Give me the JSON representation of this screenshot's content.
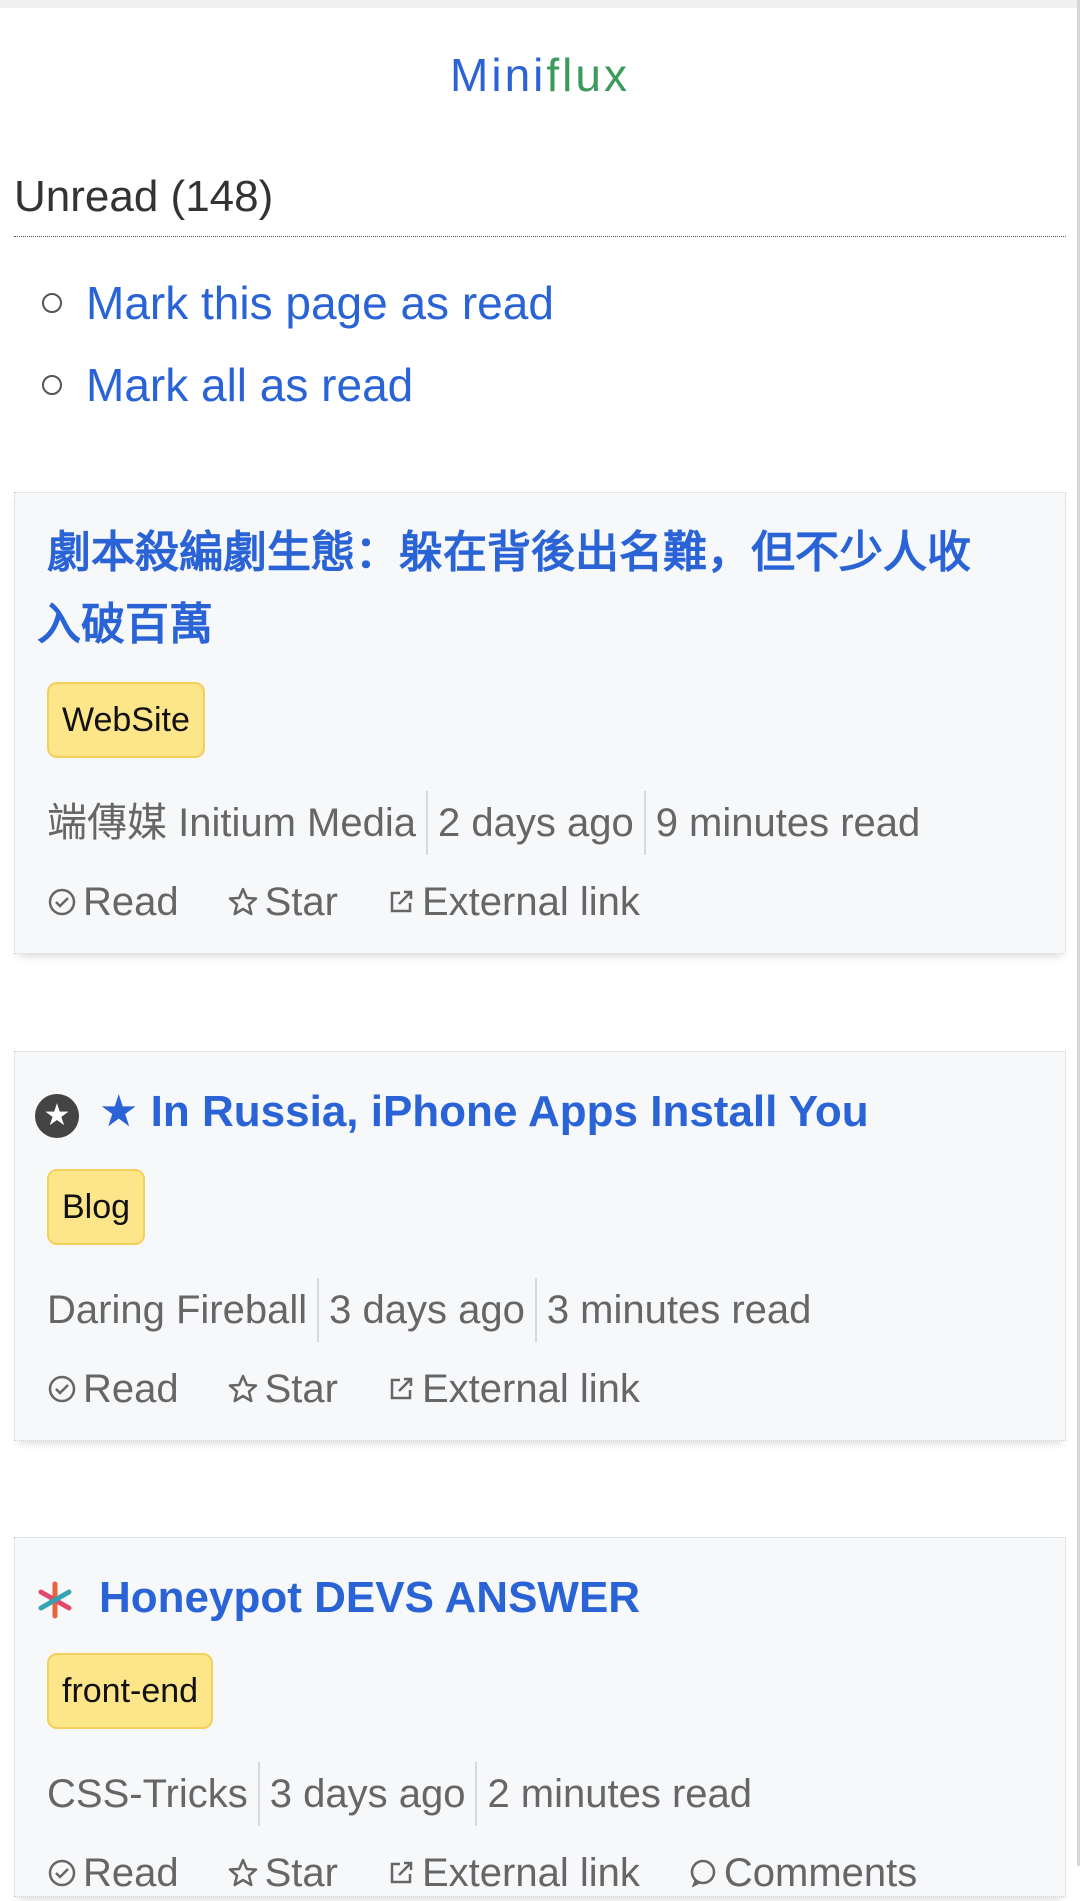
{
  "app": {
    "title_part1": "Mini",
    "title_part2": "flux"
  },
  "page": {
    "title": "Unread (148)"
  },
  "actions": [
    {
      "label": "Mark this page as read"
    },
    {
      "label": "Mark all as read"
    }
  ],
  "entries": [
    {
      "title": "劇本殺編劇生態：躲在背後出名難，但不少人收入破百萬",
      "title_line1": "劇本殺編劇生態：躲在背後出名難，但不少人收",
      "title_line2": "入破百萬",
      "tag": "WebSite",
      "feed": "端傳媒 Initium Media",
      "date": "2 days ago",
      "reading_time": "9 minutes read",
      "actions": {
        "read": "Read",
        "star": "Star",
        "external": "External link"
      }
    },
    {
      "title": "★ In Russia, iPhone Apps Install You",
      "feed_icon": "star-badge-icon",
      "tag": "Blog",
      "feed": "Daring Fireball",
      "date": "3 days ago",
      "reading_time": "3 minutes read",
      "actions": {
        "read": "Read",
        "star": "Star",
        "external": "External link"
      }
    },
    {
      "title": "Honeypot DEVS ANSWER",
      "feed_icon": "csstricks-asterisk-icon",
      "tag": "front-end",
      "feed": "CSS-Tricks",
      "date": "3 days ago",
      "reading_time": "2 minutes read",
      "actions": {
        "read": "Read",
        "star": "Star",
        "external": "External link",
        "comments": "Comments"
      }
    }
  ],
  "colors": {
    "link": "#2a63d6",
    "tag_bg": "#fde58a",
    "brand_green": "#3b9a5c"
  }
}
